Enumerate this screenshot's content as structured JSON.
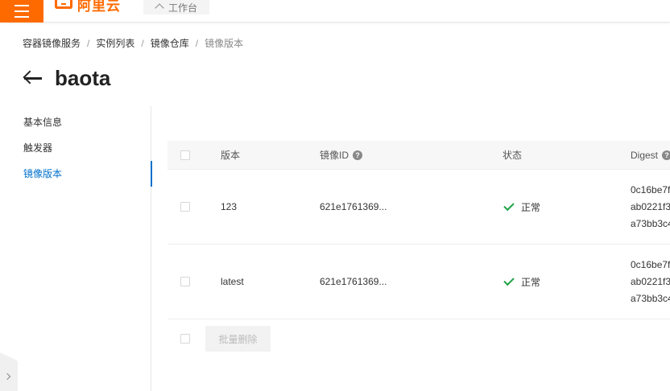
{
  "topbar": {
    "logo_text": "阿里云",
    "workbench_label": "工作台"
  },
  "breadcrumb": [
    {
      "label": "容器镜像服务"
    },
    {
      "label": "实例列表"
    },
    {
      "label": "镜像仓库"
    },
    {
      "label": "镜像版本"
    }
  ],
  "breadcrumb_sep": "/",
  "page": {
    "title": "baota"
  },
  "nav": {
    "items": [
      {
        "label": "基本信息"
      },
      {
        "label": "触发器"
      },
      {
        "label": "镜像版本"
      }
    ],
    "active_index": 2
  },
  "table": {
    "headers": {
      "version": "版本",
      "image_id": "镜像ID",
      "status": "状态",
      "digest": "Digest"
    },
    "rows": [
      {
        "version": "123",
        "image_id": "621e1761369...",
        "status": "正常",
        "digest": [
          "0c16be7f",
          "ab0221f3",
          "a73bb3c4"
        ]
      },
      {
        "version": "latest",
        "image_id": "621e1761369...",
        "status": "正常",
        "digest": [
          "0c16be7f",
          "ab0221f3",
          "a73bb3c4"
        ]
      }
    ],
    "batch_delete_label": "批量删除"
  },
  "colors": {
    "brand": "#ff6a00",
    "active": "#0070cc",
    "success": "#1fa347"
  }
}
